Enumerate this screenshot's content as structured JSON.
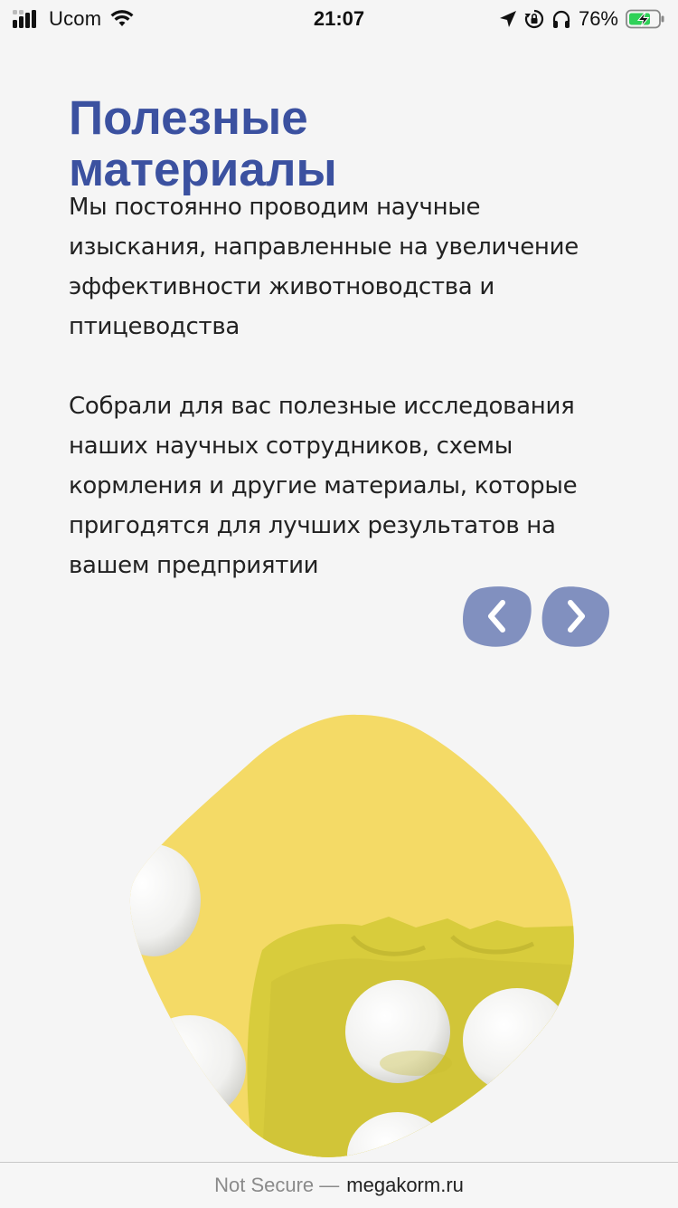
{
  "status_bar": {
    "carrier": "Ucom",
    "time": "21:07",
    "battery_percent": "76%",
    "icons": [
      "signal-icon",
      "wifi-icon",
      "location-arrow-icon",
      "orientation-lock-icon",
      "headphones-icon",
      "battery-charging-icon"
    ]
  },
  "page": {
    "title": "Полезные материалы",
    "paragraphs": [
      "Мы постоянно проводим научные изыскания, направленные на увеличение эффективности животноводства и птицеводства",
      "Собрали для вас полезные исследования наших научных сотрудников, схемы кормления и другие материалы, которые пригодятся для лучших результатов на вашем предприятии"
    ],
    "nav": {
      "prev_icon": "chevron-left-icon",
      "next_icon": "chevron-right-icon"
    },
    "colors": {
      "title": "#3b51a0",
      "nav_button": "#8190bf",
      "hero_background": "#f3d65e"
    }
  },
  "url_bar": {
    "insecure_label": "Not Secure —",
    "domain": "megakorm.ru"
  }
}
